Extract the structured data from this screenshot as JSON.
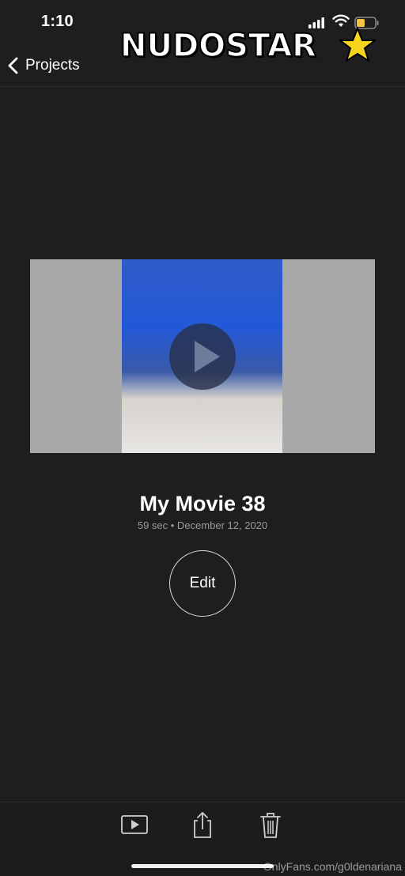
{
  "status_bar": {
    "time": "1:10"
  },
  "watermark": {
    "text": "NUDOSTAR"
  },
  "nav": {
    "back_label": "Projects"
  },
  "project": {
    "title": "My Movie 38",
    "meta": "59 sec • December 12, 2020",
    "edit_label": "Edit"
  },
  "toolbar": {
    "icons": [
      "play-icon",
      "share-icon",
      "trash-icon"
    ]
  },
  "source_watermark": "OnlyFans.com/g0ldenariana",
  "colors": {
    "background": "#1e1e20",
    "meta_text": "#9a9a9e",
    "battery_fill": "#f5c542"
  }
}
